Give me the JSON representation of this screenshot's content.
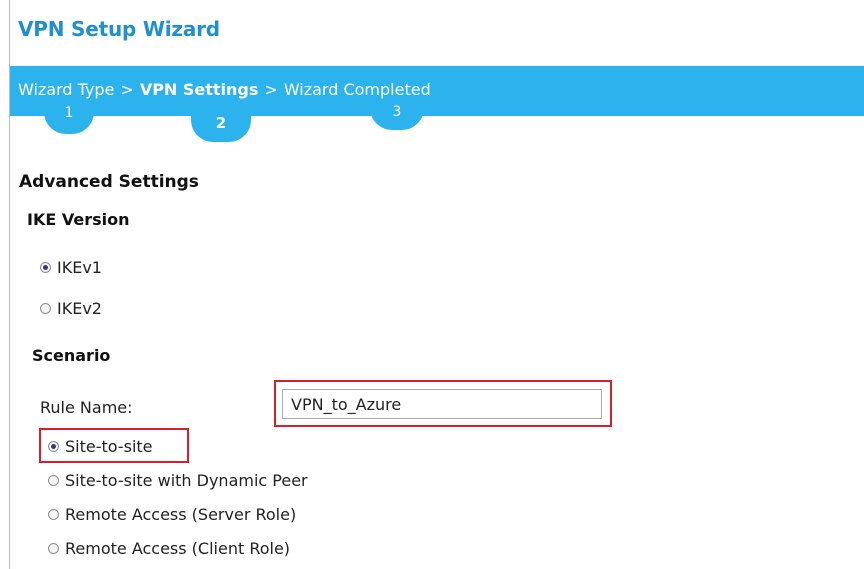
{
  "wizard": {
    "title": "VPN Setup Wizard",
    "steps": [
      {
        "label": "Wizard Type",
        "number": "1"
      },
      {
        "label": "VPN Settings",
        "number": "2"
      },
      {
        "label": "Wizard Completed",
        "number": "3"
      }
    ],
    "separator": ">"
  },
  "advanced": {
    "heading": "Advanced Settings",
    "ike": {
      "heading": "IKE Version",
      "options": [
        "IKEv1",
        "IKEv2"
      ],
      "selected": "IKEv1"
    },
    "scenario": {
      "heading": "Scenario",
      "rule_name_label": "Rule Name:",
      "rule_name_value": "VPN_to_Azure",
      "options": [
        "Site-to-site",
        "Site-to-site with Dynamic Peer",
        "Remote Access (Server Role)",
        "Remote Access (Client Role)"
      ],
      "selected": "Site-to-site"
    }
  },
  "colors": {
    "title": "#1f8fd0",
    "step_bar": "#2cb2ec",
    "highlight": "#d9202a"
  }
}
